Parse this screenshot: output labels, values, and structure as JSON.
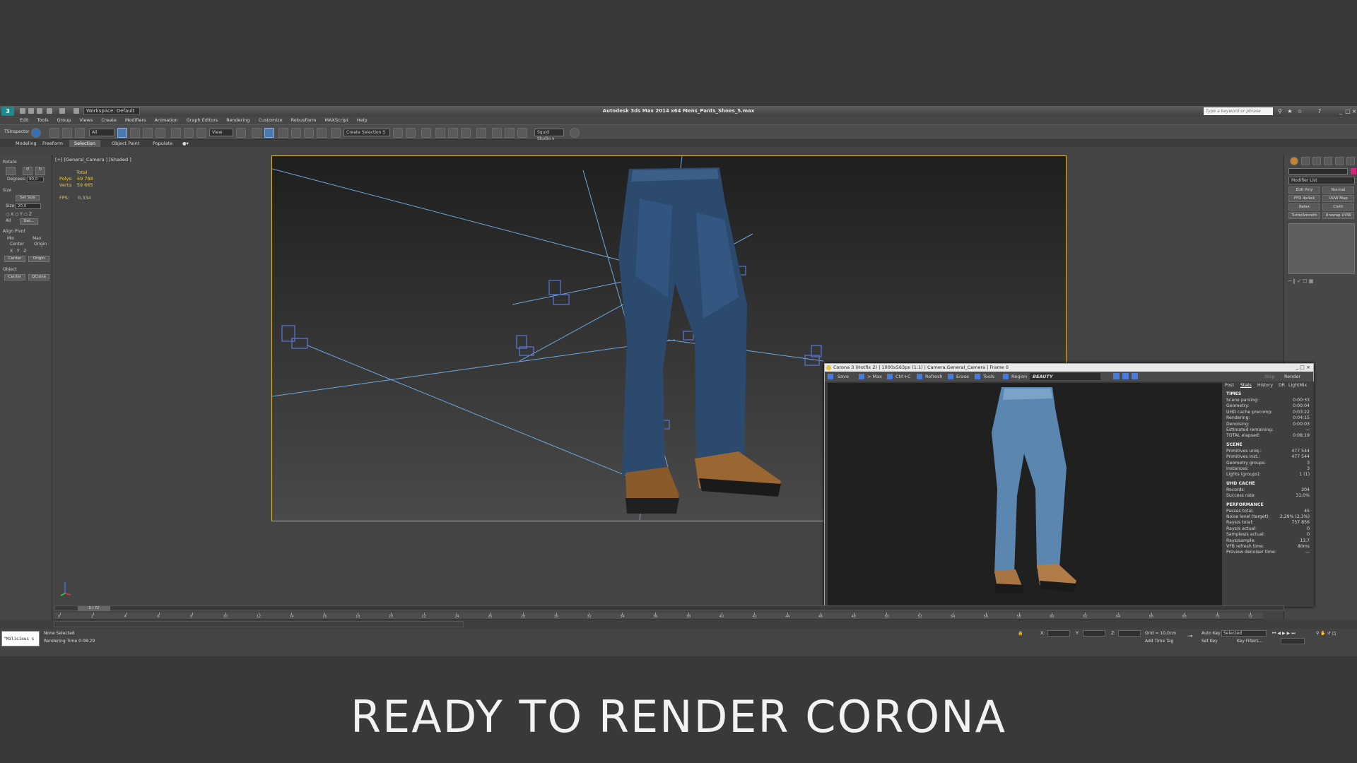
{
  "titlebar": {
    "workspace": "Workspace: Default",
    "app_title": "Autodesk 3ds Max  2014 x64      Mens_Pants_Shoes_5.max",
    "search_placeholder": "Type a keyword or phrase"
  },
  "menu": [
    "Edit",
    "Tools",
    "Group",
    "Views",
    "Create",
    "Modifiers",
    "Animation",
    "Graph Editors",
    "Rendering",
    "Customize",
    "RebusFarm",
    "MAXScript",
    "Help"
  ],
  "toolbar": {
    "ts_inspector": "TSInspector",
    "filter_all": "All",
    "ref_coord": "View",
    "create_selection": "Create Selection S",
    "squid_studio": "Squid Studio v"
  },
  "ribbon_tabs": [
    "Modeling",
    "Freeform",
    "Selection",
    "Object Paint",
    "Populate"
  ],
  "ribbon_active": "Selection",
  "left_panel": {
    "rotate": "Rotate",
    "degrees_label": "Degrees:",
    "degrees_value": "90,0",
    "size": "Size",
    "set_size": "Set Size",
    "size_label": "Size",
    "size_value": "20,0",
    "get": "Get...",
    "all": "All",
    "align_pivot": "Align Pivot",
    "min": "Min",
    "max": "Max",
    "center": "Center",
    "origin": "Origin",
    "center_btn": "Center",
    "origin_btn": "Origin",
    "object": "Object",
    "object_center": "Center",
    "qclone": "QClone"
  },
  "viewport": {
    "label": "[+] [General_Camera ] [Shaded ]",
    "stats_total": "Total",
    "polys_label": "Polys:",
    "polys_value": "59 788",
    "verts_label": "Verts:",
    "verts_value": "59 665",
    "fps_label": "FPS:",
    "fps_value": "0,334"
  },
  "right_panel": {
    "modifier_list": "Modifier List",
    "buttons": [
      "Edit Poly",
      "Normal",
      "FFD 4x4x4",
      "UVW Map",
      "Relax",
      "Cloth",
      "TurboSmooth",
      "Unwrap UVW"
    ]
  },
  "vfb": {
    "title": "Corona 3 (Hotfix 2) | 1000x563px (1:1) | Camera:General_Camera | Frame 0",
    "save": "Save",
    "to_max": "> Max",
    "ctrl_c": "Ctrl+C",
    "refresh": "Refresh",
    "erase": "Erase",
    "tools": "Tools",
    "region": "Region",
    "beauty": "BEAUTY",
    "stop": "Stop",
    "render": "Render",
    "tabs": [
      "Post",
      "Stats",
      "History",
      "DR",
      "LightMix"
    ],
    "active_tab": "Stats",
    "sections": [
      {
        "title": "TIMES",
        "rows": [
          [
            "Scene parsing:",
            "0:00:33"
          ],
          [
            "Geometry:",
            "0:00:04"
          ],
          [
            "UHD cache precomp:",
            "0:03:22"
          ],
          [
            "Rendering:",
            "0:04:15"
          ],
          [
            "Denoising:",
            "0:00:03"
          ],
          [
            "Estimated remaining:",
            "—"
          ],
          [
            "TOTAL elapsed:",
            "0:08:19"
          ]
        ]
      },
      {
        "title": "SCENE",
        "rows": [
          [
            "Primitives uniq.:",
            "477 544"
          ],
          [
            "Primitives inst.:",
            "477 544"
          ],
          [
            "Geometry groups:",
            "3"
          ],
          [
            "Instances:",
            "3"
          ],
          [
            "Lights (groups):",
            "1 (1)"
          ]
        ]
      },
      {
        "title": "UHD CACHE",
        "rows": [
          [
            "Records:",
            "204"
          ],
          [
            "Success rate:",
            "31,0%"
          ]
        ]
      },
      {
        "title": "PERFORMANCE",
        "rows": [
          [
            "Passes total:",
            "45"
          ],
          [
            "Noise level (target):",
            "2,29% (2,3%)"
          ],
          [
            "Rays/s total:",
            "757 856"
          ],
          [
            "Rays/s actual:",
            "0"
          ],
          [
            "Samples/s actual:",
            "0"
          ],
          [
            "Rays/sample:",
            "13,7"
          ],
          [
            "VFB refresh time:",
            "80ms"
          ],
          [
            "Preview denoiser time:",
            "—"
          ]
        ]
      }
    ]
  },
  "timeline": {
    "thumb": "0 / 72",
    "ticks": [
      "0",
      "2",
      "4",
      "6",
      "8",
      "10",
      "12",
      "14",
      "16",
      "18",
      "20",
      "22",
      "24",
      "26",
      "28",
      "30",
      "32",
      "34",
      "36",
      "38",
      "40",
      "42",
      "44",
      "46",
      "48",
      "50",
      "52",
      "54",
      "56",
      "58",
      "60",
      "62",
      "64",
      "66",
      "68",
      "70",
      "72"
    ]
  },
  "statusbar": {
    "maxscript": "\"Malicious s",
    "none_selected": "None Selected",
    "rendering_time": "Rendering Time  0:08:29",
    "x_label": "X:",
    "y_label": "Y:",
    "z_label": "Z:",
    "grid": "Grid = 10,0cm",
    "add_time_tag": "Add Time Tag",
    "auto_key": "Auto Key",
    "selected": "Selected",
    "set_key": "Set Key",
    "key_filters": "Key Filters..."
  },
  "banner": "READY TO RENDER  CORONA",
  "colors": {
    "viewport_border": "#d8b838",
    "camera_lines": "#6ea8e0",
    "stats_yellow": "#e8c84a"
  }
}
